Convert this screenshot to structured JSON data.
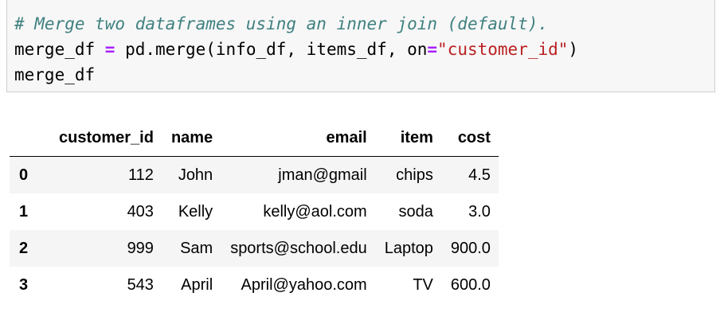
{
  "code_cell": {
    "comment": "# Merge two dataframes using an inner join (default).",
    "line2": {
      "var": "merge_df ",
      "op": "=",
      "call": " pd.merge(info_df, items_df, on",
      "eq": "=",
      "string": "\"customer_id\"",
      "close": ")"
    },
    "line3": "merge_df"
  },
  "output": {
    "columns": [
      "customer_id",
      "name",
      "email",
      "item",
      "cost"
    ],
    "rows": [
      {
        "index": "0",
        "customer_id": "112",
        "name": "John",
        "email": "jman@gmail",
        "item": "chips",
        "cost": "4.5"
      },
      {
        "index": "1",
        "customer_id": "403",
        "name": "Kelly",
        "email": "kelly@aol.com",
        "item": "soda",
        "cost": "3.0"
      },
      {
        "index": "2",
        "customer_id": "999",
        "name": "Sam",
        "email": "sports@school.edu",
        "item": "Laptop",
        "cost": "900.0"
      },
      {
        "index": "3",
        "customer_id": "543",
        "name": "April",
        "email": "April@yahoo.com",
        "item": "TV",
        "cost": "600.0"
      }
    ]
  },
  "colors": {
    "comment": "#408080",
    "operator": "#aa22ff",
    "string": "#ba2121",
    "cell_background": "#f7f7f7",
    "striped_row": "#f5f5f5"
  }
}
